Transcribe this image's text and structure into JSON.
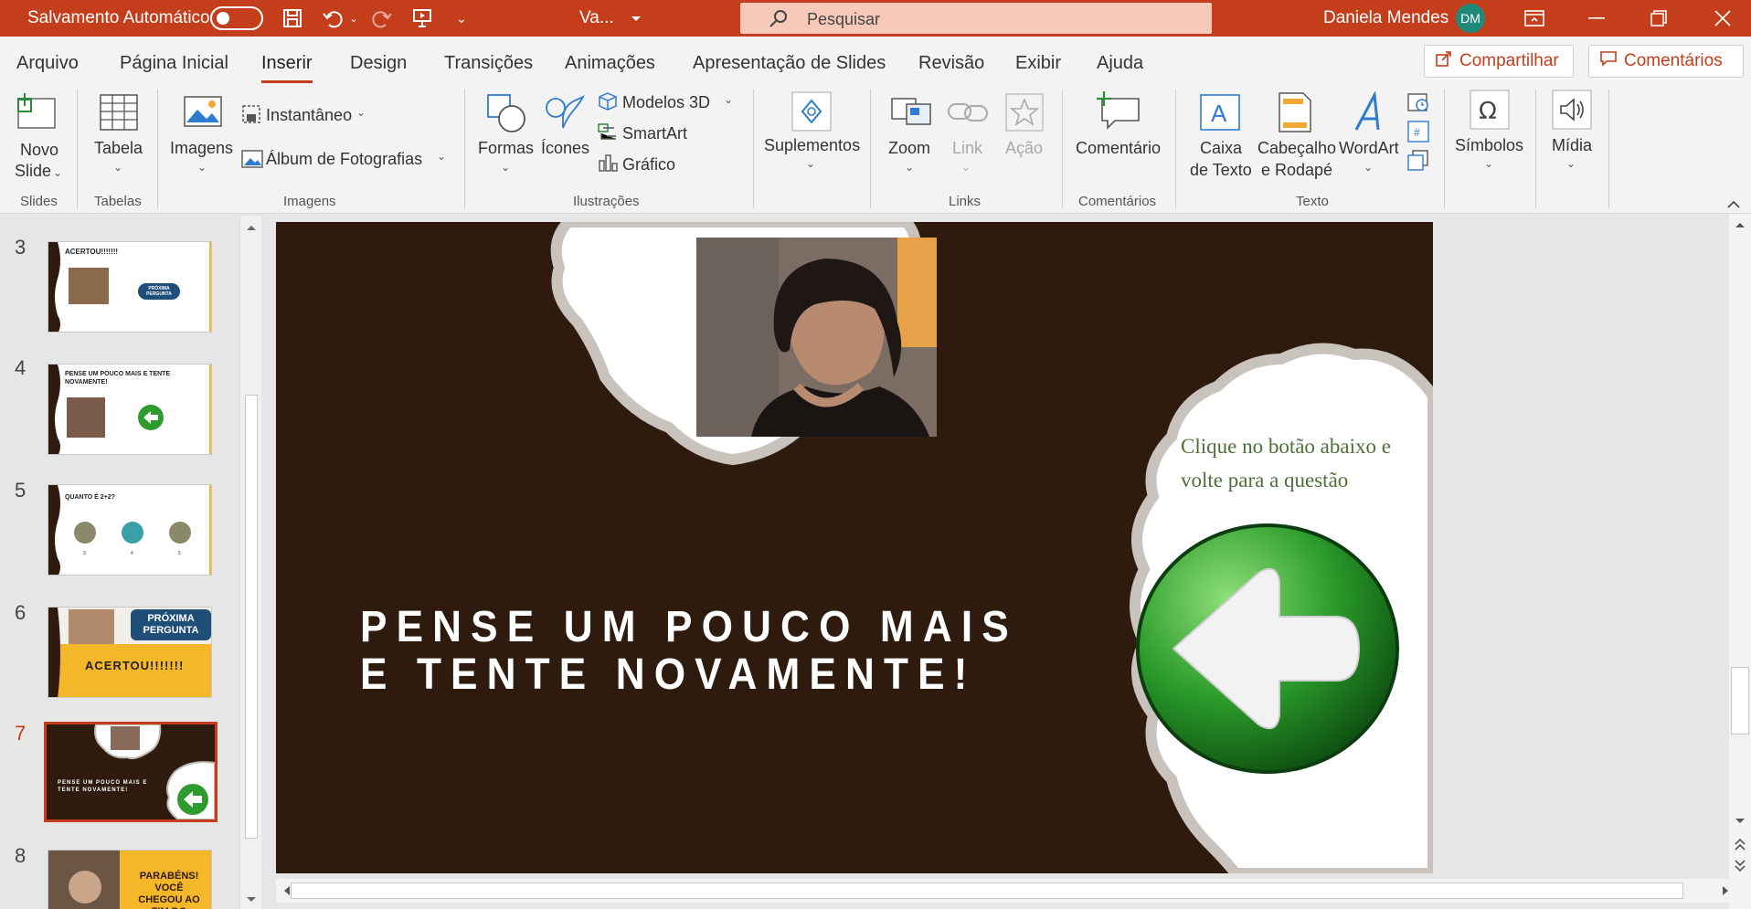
{
  "titlebar": {
    "autosave_label": "Salvamento Automático",
    "doc_title": "Va...",
    "search_placeholder": "Pesquisar",
    "user_name": "Daniela Mendes",
    "user_initials": "DM"
  },
  "tabs": [
    "Arquivo",
    "Página Inicial",
    "Inserir",
    "Design",
    "Transições",
    "Animações",
    "Apresentação de Slides",
    "Revisão",
    "Exibir",
    "Ajuda"
  ],
  "active_tab": "Inserir",
  "share_label": "Compartilhar",
  "comments_label": "Comentários",
  "ribbon": {
    "novo": "Novo",
    "slide": "Slide",
    "tabela": "Tabela",
    "imagens": "Imagens",
    "instantaneo": "Instantâneo",
    "album": "Álbum de Fotografias",
    "formas": "Formas",
    "icones": "Ícones",
    "modelos3d": "Modelos 3D",
    "smartart": "SmartArt",
    "grafico": "Gráfico",
    "suplementos": "Suplementos",
    "zoom": "Zoom",
    "link": "Link",
    "acao": "Ação",
    "comentario": "Comentário",
    "caixa1": "Caixa",
    "caixa2": "de Texto",
    "cab1": "Cabeçalho",
    "cab2": "e Rodapé",
    "wordart": "WordArt",
    "simbolos": "Símbolos",
    "midia": "Mídia",
    "groups": {
      "slides": "Slides",
      "tabelas": "Tabelas",
      "imagens": "Imagens",
      "ilustracoes": "Ilustrações",
      "links": "Links",
      "comentarios": "Comentários",
      "texto": "Texto"
    }
  },
  "thumbnails": [
    {
      "num": "3",
      "text": "ACERTOU!!!!!!!",
      "button": "PRÓXIMA PERGUNTA"
    },
    {
      "num": "4",
      "text": "PENSE UM POUCO MAIS E TENTE NOVAMENTE!"
    },
    {
      "num": "5",
      "text": "QUANTO É 2+2?",
      "options": [
        "3",
        "4",
        "5"
      ]
    },
    {
      "num": "6",
      "text": "ACERTOU!!!!!!!",
      "button": "PRÓXIMA PERGUNTA"
    },
    {
      "num": "7",
      "text": "PENSE UM POUCO MAIS E TENTE NOVAMENTE!"
    },
    {
      "num": "8",
      "text": "PARABÉNS! VOCÊ CHEGOU AO FIM DO JOGO!!"
    }
  ],
  "active_slide": "7",
  "slide": {
    "title_line1": "PENSE UM POUCO MAIS",
    "title_line2": "E TENTE NOVAMENTE!",
    "instruction": "Clique no botão abaixo e volte para a questão"
  },
  "colors": {
    "accent": "#c43e1c",
    "slide_bg": "#2e1b0d",
    "thumb_yellow": "#f4b72a",
    "instruction_green": "#4e6f3a"
  }
}
